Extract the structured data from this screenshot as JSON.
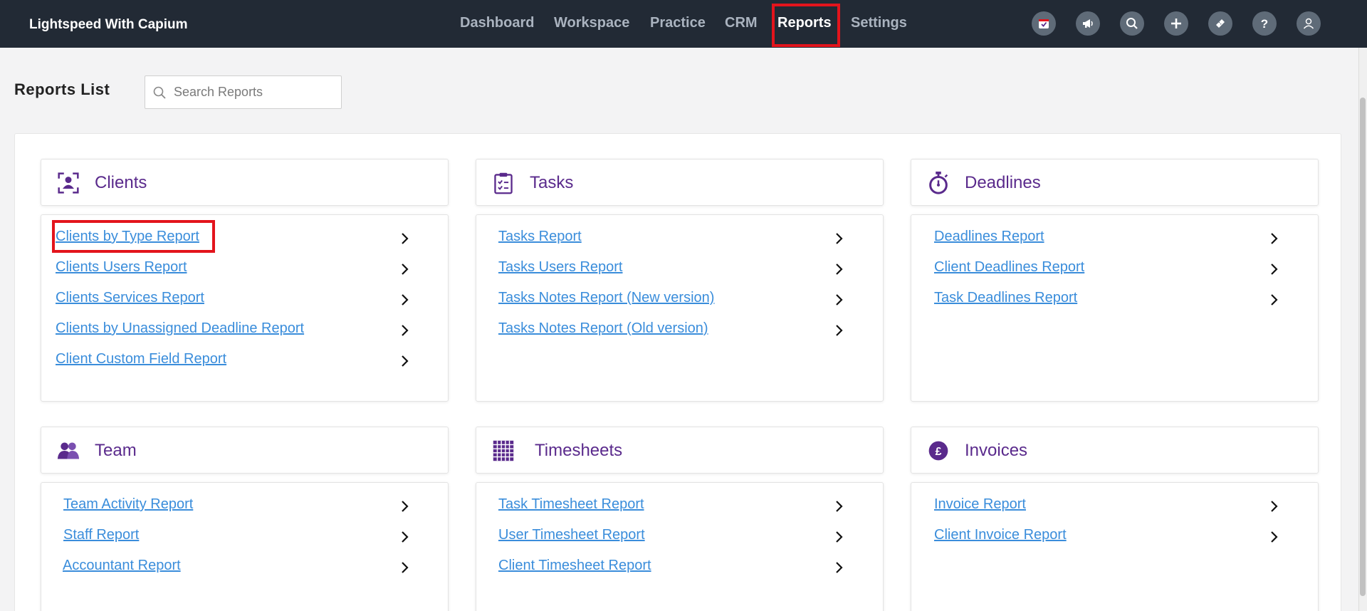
{
  "app": {
    "brand": "Lightspeed With Capium"
  },
  "nav": [
    {
      "label": "Dashboard"
    },
    {
      "label": "Workspace"
    },
    {
      "label": "Practice"
    },
    {
      "label": "CRM"
    },
    {
      "label": "Reports",
      "active": true
    },
    {
      "label": "Settings"
    }
  ],
  "top_icons": [
    "calendar-icon",
    "megaphone-icon",
    "search-icon",
    "plus-icon",
    "ticket-icon",
    "help-icon",
    "user-icon"
  ],
  "page": {
    "title": "Reports List",
    "search_placeholder": "Search Reports"
  },
  "sections": {
    "clients": {
      "title": "Clients",
      "icon": "client-icon",
      "links": [
        "Clients by Type Report",
        "Clients Users Report",
        "Clients Services Report",
        "Clients by Unassigned Deadline Report",
        "Client Custom Field Report"
      ]
    },
    "tasks": {
      "title": "Tasks",
      "icon": "clipboard-icon",
      "links": [
        "Tasks Report",
        "Tasks Users Report",
        "Tasks Notes Report (New version)",
        "Tasks Notes Report (Old version)"
      ]
    },
    "deadlines": {
      "title": "Deadlines",
      "icon": "stopwatch-icon",
      "links": [
        "Deadlines Report",
        "Client Deadlines Report",
        "Task Deadlines Report"
      ]
    },
    "team": {
      "title": "Team",
      "icon": "team-icon",
      "links": [
        "Team Activity Report",
        "Staff Report",
        "Accountant Report"
      ]
    },
    "timesheets": {
      "title": "Timesheets",
      "icon": "grid-icon",
      "links": [
        "Task Timesheet Report",
        "User Timesheet Report",
        "Client Timesheet Report"
      ]
    },
    "invoices": {
      "title": "Invoices",
      "icon": "pound-icon",
      "icon_text": "£",
      "links": [
        "Invoice Report",
        "Client Invoice Report"
      ]
    }
  },
  "colors": {
    "topbar": "#222a35",
    "accent_purple": "#5a2a8c",
    "link": "#3a8ddb",
    "highlight": "#e3141c"
  }
}
